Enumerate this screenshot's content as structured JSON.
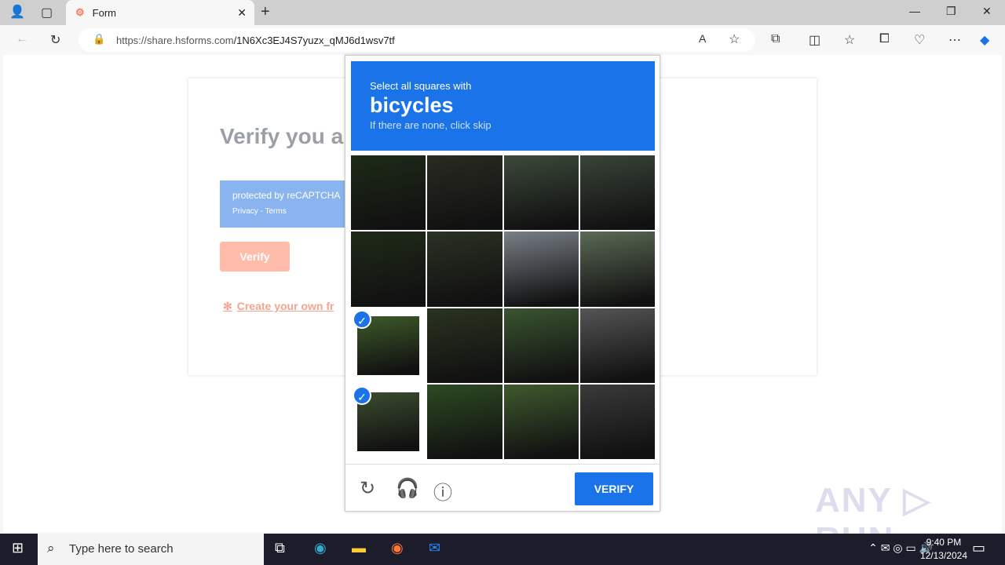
{
  "browser": {
    "tab_title": "Form",
    "url_host": "https://share.hsforms.com",
    "url_path": "/1N6Xc3EJ4S7yuzx_qMJ6d1wsv7tf"
  },
  "form": {
    "heading": "Verify you a",
    "recaptcha_text": "protected by reCAPTCHA",
    "recaptcha_links": "Privacy - Terms",
    "verify_label": "Verify",
    "create_link": "Create your own fr"
  },
  "captcha": {
    "instruction": "Select all squares with",
    "target": "bicycles",
    "hint": "If there are none, click skip",
    "verify_label": "VERIFY",
    "selected_tiles": [
      8,
      12
    ],
    "accent": "#1a73e8"
  },
  "watermark": "ANY RUN",
  "taskbar": {
    "search_placeholder": "Type here to search",
    "time": "9:40 PM",
    "date": "12/13/2024"
  }
}
